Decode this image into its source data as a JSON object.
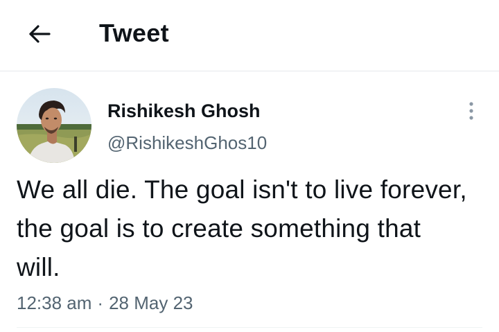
{
  "header": {
    "back_icon": "arrow-left-icon",
    "title": "Tweet"
  },
  "tweet": {
    "author": {
      "display_name": "Rishikesh Ghosh",
      "handle": "@RishikeshGhos10",
      "avatar": "profile-photo"
    },
    "more_icon": "vertical-ellipsis-icon",
    "text": "We all die. The goal isn't to live forever, the goal is to create something that will.",
    "time": "12:38 am",
    "separator": "·",
    "date": "28 May 23"
  },
  "colors": {
    "text_primary": "#0f1419",
    "text_secondary": "#536471",
    "divider": "#e6e9ec"
  }
}
